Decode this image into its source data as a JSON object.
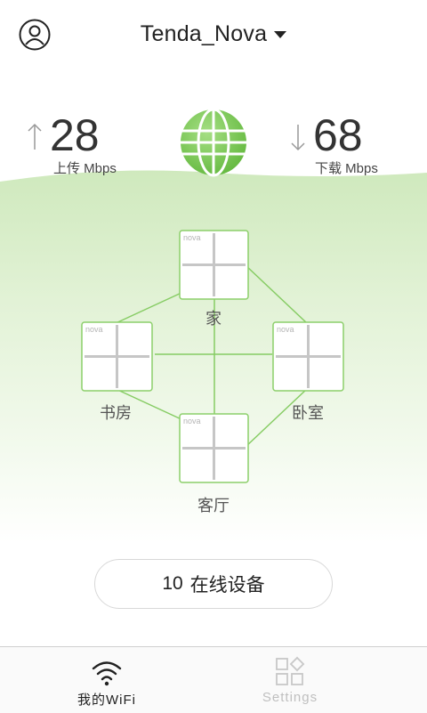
{
  "header": {
    "ssid": "Tenda_Nova",
    "profile_icon": "user-circle-icon",
    "dropdown_icon": "caret-down-icon"
  },
  "speed": {
    "upload_value": "28",
    "upload_label": "上传 Mbps",
    "download_value": "68",
    "download_label": "下载 Mbps",
    "internet_icon": "globe-icon"
  },
  "topology": {
    "nodes": [
      {
        "tag": "nova",
        "room": "家"
      },
      {
        "tag": "nova",
        "room": "书房"
      },
      {
        "tag": "nova",
        "room": "卧室"
      },
      {
        "tag": "nova",
        "room": "客厅"
      }
    ]
  },
  "devices": {
    "count": "10",
    "label": "在线设备"
  },
  "tabbar": {
    "tabs": [
      {
        "label": "我的WiFi",
        "icon": "wifi-icon",
        "active": true
      },
      {
        "label": "Settings",
        "icon": "settings-grid-icon",
        "active": false
      }
    ]
  },
  "colors": {
    "accent": "#7cc85a",
    "accent_light": "#e3f3d9",
    "text": "#222222",
    "inactive": "#bfbfbf"
  }
}
